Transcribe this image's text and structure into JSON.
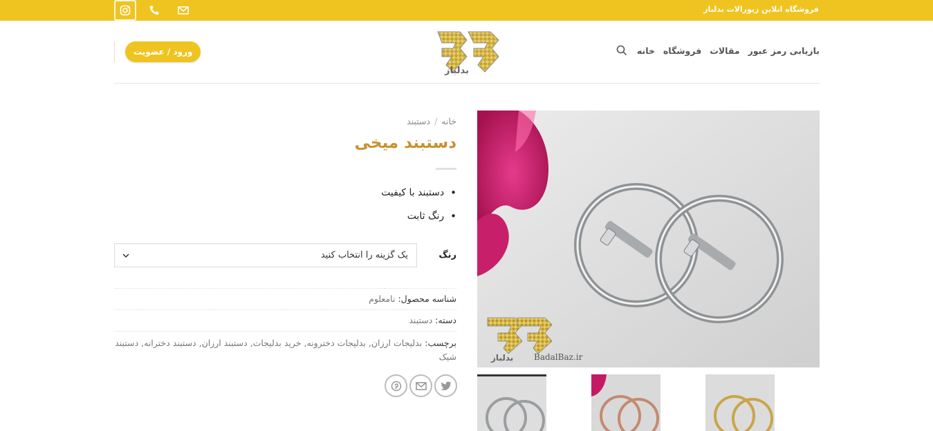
{
  "topbar": {
    "tagline": "فروشگاه انلاین زیورالات بدلباز",
    "icons": [
      "instagram-icon",
      "phone-icon",
      "mail-icon"
    ],
    "background_color": "#efc420"
  },
  "header": {
    "login_label": "ورود / عضویت",
    "logo_text": "بدلباز",
    "nav": [
      "خانه",
      "فروشگاه",
      "مقالات",
      "بازیابی رمز عبور"
    ],
    "accent_color": "#efc420"
  },
  "product": {
    "breadcrumb": [
      "خانه",
      "دستبند"
    ],
    "breadcrumb_sep": "/",
    "title": "دستبند میخی",
    "title_color": "#c9912c",
    "features": [
      "دستبند با کیفیت",
      "رنگ ثابت"
    ],
    "color_label": "رنگ",
    "color_select_value": "یک گزینه را انتخاب کنید",
    "sku_label": "شناسه محصول:",
    "sku_value": "نامعلوم",
    "category_label": "دسته:",
    "category_value": "دستبند",
    "tags_label": "برچسب:",
    "tags_value": "بدلیجات ارزان, بدلیجات دخترونه, خرید بدلیجات, دستبند ارزان, دستبند دخترانه, دستبند شیک",
    "share_icons": [
      "twitter-icon",
      "email-icon",
      "pinterest-icon"
    ]
  },
  "gallery": {
    "watermark_logo": "بدلباز",
    "watermark_url": "BadalBaz.ir",
    "thumbnails": [
      "silver",
      "rose-gold",
      "gold"
    ]
  }
}
